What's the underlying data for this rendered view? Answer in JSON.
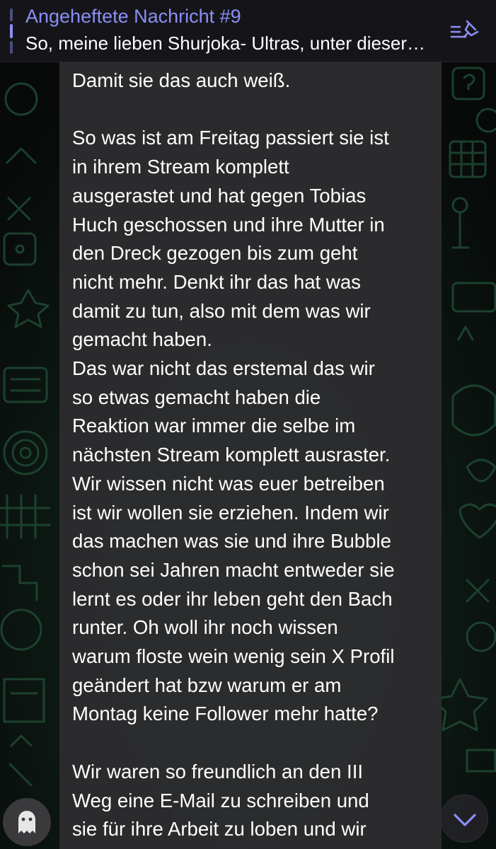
{
  "pinned": {
    "title": "Angeheftete Nachricht #9",
    "preview": "So, meine lieben Shurjoka- Ultras, unter dieser…",
    "icon": "pin-list-icon",
    "accent_color": "#8b8ff5"
  },
  "message": {
    "paragraphs": [
      "Damit sie das auch weiß.",
      "So was ist am Freitag passiert sie ist\nin ihrem Stream komplett\nausgerastet und hat gegen Tobias\nHuch geschossen und ihre Mutter in\nden Dreck gezogen bis zum geht\nnicht mehr. Denkt ihr das hat was\ndamit zu tun, also mit dem was wir\ngemacht haben.\nDas war nicht das erstemal das wir\nso etwas gemacht haben die\nReaktion war immer die selbe im\nnächsten Stream komplett ausraster.\nWir wissen nicht was euer betreiben\nist wir wollen sie erziehen. Indem wir\ndas machen was sie und ihre Bubble\nschon sei Jahren macht entweder sie\nlernt es oder ihr leben geht den Bach\nrunter. Oh woll ihr noch wissen\nwarum floste wein wenig sein X Profil\ngeändert hat bzw warum er am\nMontag keine Follower mehr hatte?",
      "Wir waren so freundlich an den III\nWeg eine E-Mail zu schreiben und\nsie für ihre Arbeit zu loben und wir"
    ]
  },
  "buttons": {
    "avatar_icon": "ghost-icon",
    "scroll_down_icon": "chevron-down-icon"
  },
  "colors": {
    "background": "#0b0f0d",
    "bubble": "#2c2c2e",
    "doodle": "#1f3a2b"
  }
}
